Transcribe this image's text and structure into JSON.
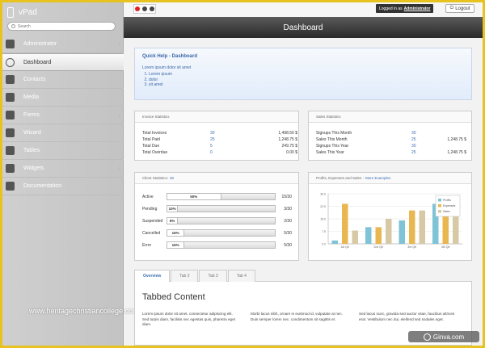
{
  "app": {
    "title": "vPad"
  },
  "sidebar": {
    "search_placeholder": "Search",
    "items": [
      {
        "label": "Administrator",
        "icon": "user-icon"
      },
      {
        "label": "Dashboard",
        "icon": "speedometer-icon",
        "active": true
      },
      {
        "label": "Contacts",
        "icon": "contacts-icon"
      },
      {
        "label": "Media",
        "icon": "media-icon"
      },
      {
        "label": "Forms",
        "icon": "forms-icon"
      },
      {
        "label": "Wizard",
        "icon": "wand-icon"
      },
      {
        "label": "Tables",
        "icon": "table-icon"
      },
      {
        "label": "Widgets",
        "icon": "gear-icon"
      },
      {
        "label": "Documentation",
        "icon": "book-icon"
      }
    ],
    "watermark": "www.heritagechristiancollege.com"
  },
  "topbar": {
    "logged_prefix": "Logged in as",
    "logged_user": "Administrator",
    "logout_label": "Logout"
  },
  "header": {
    "title": "Dashboard"
  },
  "quick_help": {
    "title": "Quick Help - Dashboard",
    "text": "Lorem ipsum dolor sit amet",
    "items": [
      "Lorem ipsum",
      "dolor",
      "sit amet"
    ]
  },
  "invoice": {
    "title": "Invoice Statistics",
    "rows": [
      {
        "label": "Total Invoices",
        "count": "30",
        "amount": "1,498.50 $"
      },
      {
        "label": "Total Paid",
        "count": "25",
        "amount": "1,248.75 $"
      },
      {
        "label": "Total Due",
        "count": "5",
        "amount": "249.75 $"
      },
      {
        "label": "Total Overdue",
        "count": "0",
        "amount": "0.00 $"
      }
    ]
  },
  "sales": {
    "title": "Sales Statistics",
    "rows": [
      {
        "label": "Signups This Month",
        "count": "30",
        "amount": ""
      },
      {
        "label": "Sales This Month",
        "count": "25",
        "amount": "1,248.75 $"
      },
      {
        "label": "Signups This Year",
        "count": "30",
        "amount": ""
      },
      {
        "label": "Sales This Year",
        "count": "25",
        "amount": "1,248.75 $"
      }
    ]
  },
  "client": {
    "title": "Client Statistics:",
    "total": "30",
    "rows": [
      {
        "label": "Active",
        "percent": 50,
        "pct_label": "50%",
        "count": "15/30"
      },
      {
        "label": "Pending",
        "percent": 10,
        "pct_label": "10%",
        "count": "3/30"
      },
      {
        "label": "Suspended",
        "percent": 6,
        "pct_label": "6%",
        "count": "2/30"
      },
      {
        "label": "Cancelled",
        "percent": 16,
        "pct_label": "16%",
        "count": "5/30"
      },
      {
        "label": "Error",
        "percent": 16,
        "pct_label": "16%",
        "count": "5/30"
      }
    ]
  },
  "profits": {
    "title": "Profits, Expenses and Sales -",
    "link": "More Examples"
  },
  "chart_data": {
    "type": "bar",
    "categories": [
      "1st Qtr",
      "2nd Qtr",
      "3rd Qtr",
      "4th Qtr"
    ],
    "series": [
      {
        "name": "Profits",
        "values": [
          2,
          10,
          14,
          24
        ]
      },
      {
        "name": "Expenses",
        "values": [
          24,
          10,
          20,
          21
        ]
      },
      {
        "name": "Sales",
        "values": [
          8,
          15,
          20,
          28
        ]
      }
    ],
    "colors": [
      "#7fc3d6",
      "#e8b752",
      "#d8c9a6"
    ],
    "ylim": [
      0,
      30
    ],
    "yticks": [
      "0.0",
      "7.5",
      "15.0",
      "22.5",
      "30.0"
    ],
    "legend": "top-right",
    "grid": true
  },
  "tabs": {
    "items": [
      "Overview",
      "Tab 2",
      "Tab 3",
      "Tab 4"
    ],
    "active": 0,
    "content_title": "Tabbed Content",
    "columns": [
      "Lorem ipsum dolor sit amet, consectetur adipiscing elit. Sed turpis diam, facilisis nec egestas quis, pharetra eget diam.",
      "Morbi lacus nibh, ornare in euismod id, vulputate at nec. Duis semper lorem nec. condimentum sit sagittis et.",
      "Sed lacus nunc, gravida sed auctor vitae, faucibus ultrices erat. Vestibulum nec dui, eleifend sed sodales eget."
    ]
  },
  "badge": {
    "text": "Ginva.com"
  }
}
